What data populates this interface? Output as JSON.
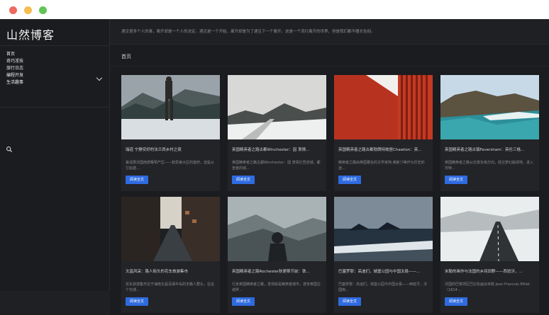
{
  "window": {
    "controls": [
      "close",
      "minimize",
      "maximize"
    ]
  },
  "sidebar": {
    "site_title": "山然博客",
    "nav": [
      {
        "label": "首页"
      },
      {
        "label": "奇巧淫技"
      },
      {
        "label": "旅行日志"
      },
      {
        "label": "编程开发"
      },
      {
        "label": "生活趣事"
      }
    ],
    "search_icon": "search-icon"
  },
  "notice": {
    "text": "遇见很多个人的事，离开却是一个人的决定。遇见是一个开始，离开却是为了遇见下一个离开。这是一个流行离开的世界，但是我们都不擅长告别。"
  },
  "main": {
    "section_title": "首页",
    "read_label": "阅读全文",
    "cards": [
      {
        "title": "瑞道 宁静安好的法兰西乡村之夜",
        "excerpt": "第戎那法国南部葡萄产区——勃艮第大区的首府，但是从它始建..."
      },
      {
        "title": "英国精英者之路古都Winchester：因 衷情...",
        "excerpt": "英国精英者之路古都Winchester：因 衷情钉吾容城，都宣者的城..."
      },
      {
        "title": "英国精英者之路古都勃朗特故居Chawton：英...",
        "excerpt": "精英者之路由英国著名的文学家简·奥斯汀等作为历史的迷..."
      },
      {
        "title": "英国精英者之路古镇Faversham：英伦三格...",
        "excerpt": "英国精英者之路从伦敦东南方向，经过梦幻般绿地，进入坎特..."
      },
      {
        "title": "文昌风采：路人街头的花车旅游集市",
        "excerpt": "花车旅游集市位于海南文昌清澜半岛的无路人群头，在这个交通..."
      },
      {
        "title": "英国精英者之路Rochester狄更斯节前：铁...",
        "excerpt": "行走英国精英者之路，发现就是精英者城市，游览英国古城罗..."
      },
      {
        "title": "巴塞罗那：高迪们，城堡公园与中国太极——...",
        "excerpt": "巴塞罗那：高迪们，城堡公园与中国太极——西班牙，法国南..."
      },
      {
        "title": "米勒的画作与法国的乡间田野——西班牙，...",
        "excerpt": "法国的巴黎郊区巴比松画派米勒 Jean-Francois Millet（1814-..."
      }
    ]
  }
}
